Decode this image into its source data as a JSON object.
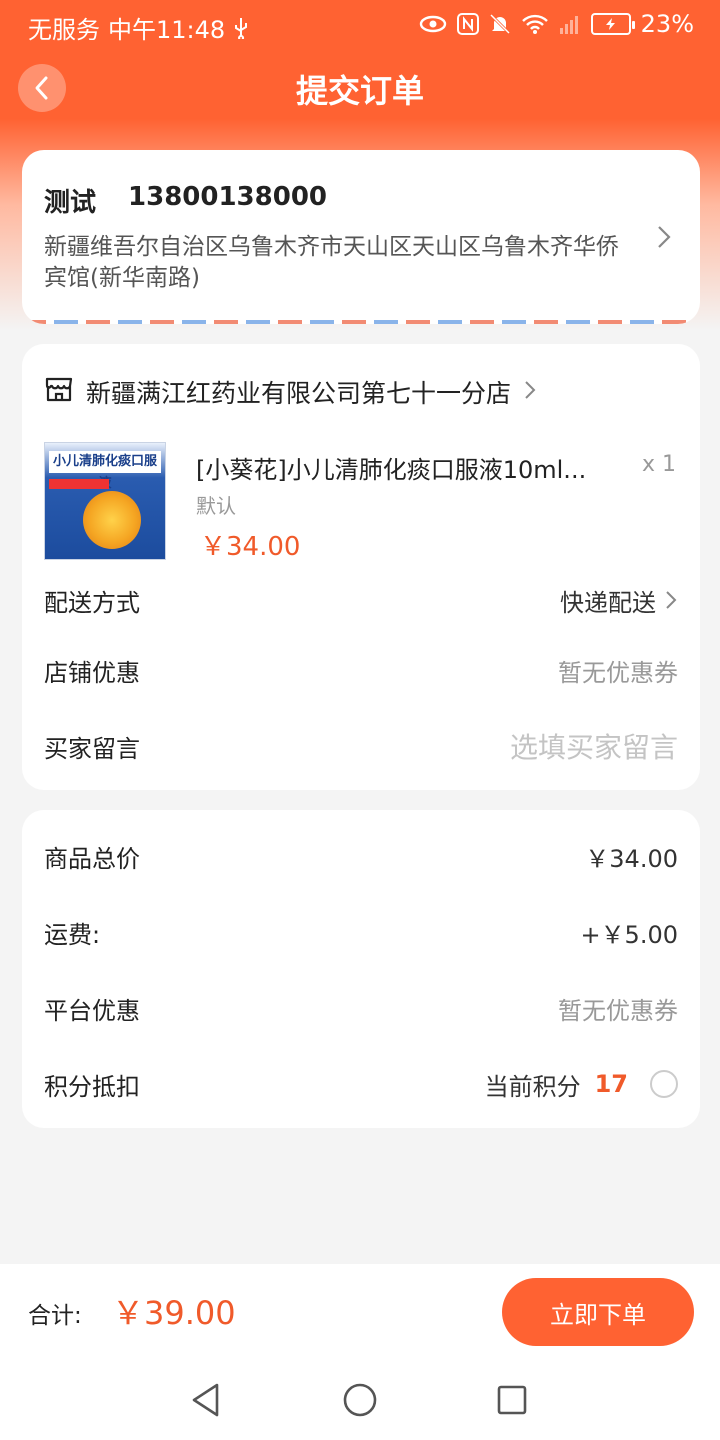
{
  "status_bar": {
    "carrier": "无服务",
    "time": "中午11:48",
    "battery": "23%"
  },
  "header": {
    "title": "提交订单"
  },
  "address": {
    "name": "测试",
    "phone": "13800138000",
    "detail": "新疆维吾尔自治区乌鲁木齐市天山区天山区乌鲁木齐华侨宾馆(新华南路)"
  },
  "store": {
    "name": "新疆满江红药业有限公司第七十一分店"
  },
  "product": {
    "image_title": "小儿清肺化痰口服液",
    "name": "[小葵花]小儿清肺化痰口服液10ml...",
    "qty": "x 1",
    "spec": "默认",
    "price": "￥34.00"
  },
  "order_rows": {
    "delivery_label": "配送方式",
    "delivery_value": "快递配送",
    "store_discount_label": "店铺优惠",
    "store_discount_value": "暂无优惠券",
    "message_label": "买家留言",
    "message_placeholder": "选填买家留言"
  },
  "summary": {
    "goods_total_label": "商品总价",
    "goods_total_value": "￥34.00",
    "shipping_label": "运费:",
    "shipping_value": "+￥5.00",
    "platform_discount_label": "平台优惠",
    "platform_discount_value": "暂无优惠券",
    "points_label": "积分抵扣",
    "points_current_label": "当前积分",
    "points_value": "17"
  },
  "footer": {
    "total_label": "合计:",
    "total_amount": "￥39.00",
    "submit_label": "立即下单"
  },
  "colors": {
    "accent": "#ff6232",
    "price": "#f05a2a"
  }
}
